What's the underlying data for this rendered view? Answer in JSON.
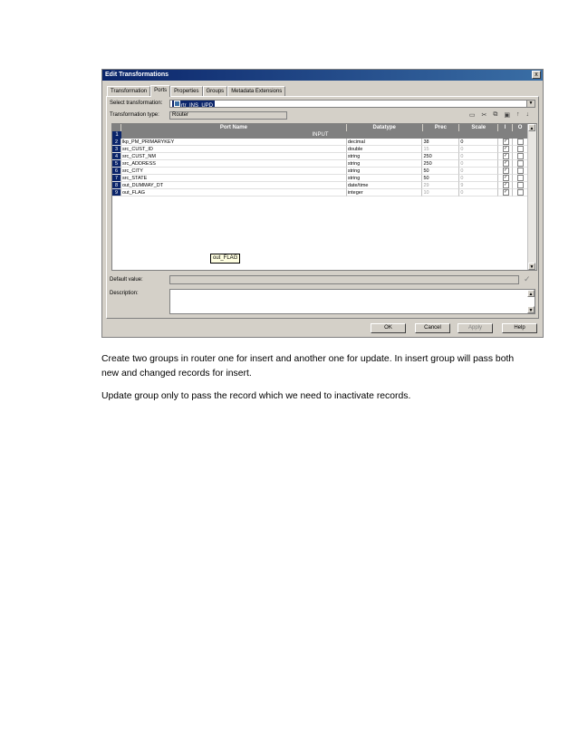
{
  "dialog": {
    "title": "Edit Transformations",
    "close_label": "x",
    "tabs": [
      "Transformation",
      "Ports",
      "Properties",
      "Groups",
      "Metadata Extensions"
    ],
    "select_label": "Select transformation:",
    "select_value": "rtr_INS_UPD",
    "type_label": "Transformation type:",
    "type_value": "Router",
    "columns": [
      "Port Name",
      "Datatype",
      "Prec",
      "Scale",
      "I",
      "O"
    ],
    "group_label": "INPUT",
    "group_rownum": "1",
    "rows": [
      {
        "num": "2",
        "name": "lkp_PM_PRIMARYKEY",
        "type": "decimal",
        "prec": "38",
        "scale": "0",
        "prec_muted": false,
        "scale_muted": false
      },
      {
        "num": "3",
        "name": "src_CUST_ID",
        "type": "double",
        "prec": "15",
        "scale": "0",
        "prec_muted": true,
        "scale_muted": true
      },
      {
        "num": "4",
        "name": "src_CUST_NM",
        "type": "string",
        "prec": "250",
        "scale": "0",
        "prec_muted": false,
        "scale_muted": true
      },
      {
        "num": "5",
        "name": "src_ADDRESS",
        "type": "string",
        "prec": "250",
        "scale": "0",
        "prec_muted": false,
        "scale_muted": true
      },
      {
        "num": "6",
        "name": "src_CITY",
        "type": "string",
        "prec": "50",
        "scale": "0",
        "prec_muted": false,
        "scale_muted": true
      },
      {
        "num": "7",
        "name": "src_STATE",
        "type": "string",
        "prec": "50",
        "scale": "0",
        "prec_muted": false,
        "scale_muted": true
      },
      {
        "num": "8",
        "name": "out_DUMMAY_DT",
        "type": "date/time",
        "prec": "29",
        "scale": "9",
        "prec_muted": true,
        "scale_muted": true
      },
      {
        "num": "9",
        "name": "out_FLAG",
        "type": "integer",
        "prec": "10",
        "scale": "0",
        "prec_muted": true,
        "scale_muted": true
      }
    ],
    "tooltip": "out_FLAG",
    "default_label": "Default value:",
    "description_label": "Description:",
    "buttons": {
      "ok": "OK",
      "cancel": "Cancel",
      "apply": "Apply",
      "help": "Help"
    }
  },
  "text": {
    "para1": "Create two groups in router one for insert and another one for update. In insert group will pass both new and changed records for insert.",
    "para2": "Update group only to pass the record which we need to inactivate records."
  }
}
